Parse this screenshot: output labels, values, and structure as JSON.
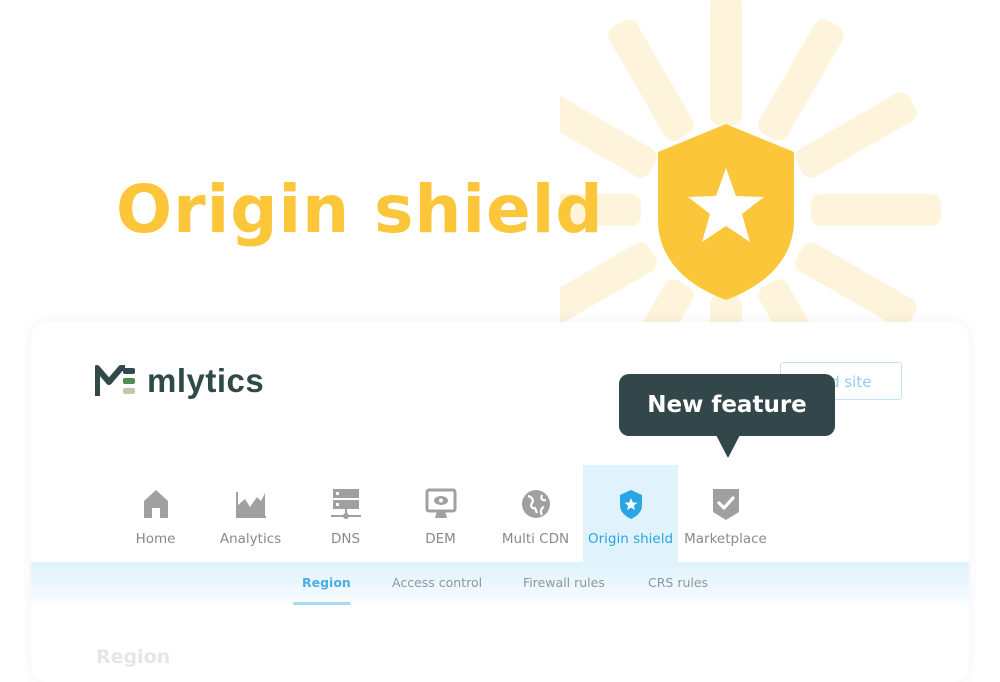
{
  "hero": {
    "title": "Origin shield",
    "accent_color": "#fcc63a"
  },
  "app": {
    "brand": "mlytics",
    "add_site_label": "Add site",
    "tooltip": "New feature",
    "nav": [
      {
        "label": "Home",
        "icon": "home-icon",
        "active": false
      },
      {
        "label": "Analytics",
        "icon": "area-chart-icon",
        "active": false
      },
      {
        "label": "DNS",
        "icon": "server-network-icon",
        "active": false
      },
      {
        "label": "DEM",
        "icon": "monitor-eye-icon",
        "active": false
      },
      {
        "label": "Multi CDN",
        "icon": "globe-icon",
        "active": false
      },
      {
        "label": "Origin shield",
        "icon": "shield-star-icon",
        "active": true
      },
      {
        "label": "Marketplace",
        "icon": "badge-check-icon",
        "active": false
      }
    ],
    "subtabs": [
      {
        "label": "Region",
        "active": true
      },
      {
        "label": "Access control",
        "active": false
      },
      {
        "label": "Firewall rules",
        "active": false
      },
      {
        "label": "CRS rules",
        "active": false
      }
    ],
    "section_title": "Region",
    "colors": {
      "active_blue": "#29a5e3",
      "inactive_gray": "#8a8a8a",
      "tooltip_bg": "#33474a",
      "brand_dark": "#2f4a49"
    }
  }
}
